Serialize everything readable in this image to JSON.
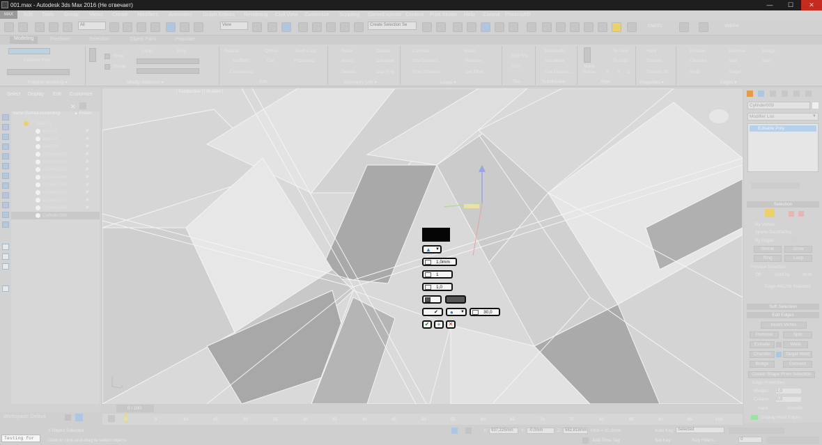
{
  "window": {
    "title": "001.max - Autodesk 3ds Max 2016 (Не отвечает)",
    "minimize": "—",
    "maximize": "☐",
    "close": "✕"
  },
  "app_logo": "MAX",
  "menu": [
    "Edit",
    "Tools",
    "Group",
    "Views",
    "Create",
    "Modifiers",
    "Animation",
    "Graph Editors",
    "Rendering",
    "Civil View",
    "Customize",
    "Scripting",
    "GameExporter",
    "Content",
    "Print Studio",
    "Help",
    "Corona",
    "PhoenixFD"
  ],
  "toolbar": {
    "selection_filter": "All",
    "ref_coord": "View",
    "named_sel": "Create Selection Se",
    "cmpp2": "CMPP2",
    "vmpp4": "VMPP4"
  },
  "ribbon": {
    "tabs": [
      "Modeling",
      "Freeform",
      "Selection",
      "Object Paint",
      "Populate"
    ],
    "editable_poly": "Editable Poly",
    "grow": "Grow",
    "shrink": "Shrink",
    "loop": "Loop",
    "ring": "Ring",
    "repeat": "Repeat",
    "nurms": "NURMS",
    "constraints": "Constraints:",
    "qslice": "QSlice",
    "cut": "Cut",
    "p_connect": "P Connect",
    "swift_loop": "Swift Loop",
    "relax": "Relax",
    "attach": "Attach",
    "detach": "Detach",
    "create": "Create",
    "collapse": "Collapse",
    "cap_poly": "Cap Poly",
    "connect": "Connect",
    "dist_connect": "Dist Connect",
    "flow_connect": "Flow Connect",
    "insert": "Insert",
    "remove_loop": "Remove",
    "set_flow": "Set Flow",
    "edit_tris": "Edit Tris",
    "turn": "Turn",
    "msmooth": "MSmooth",
    "tessellate": "Tessellate",
    "use_displac": "Use Displac...",
    "make_planar": "Make Planar",
    "to_view": "To View",
    "to_grid": "To Grid",
    "xyz": [
      "X",
      "Y",
      "Z"
    ],
    "hard": "Hard",
    "smooth": "Smooth",
    "smooth30": "Smooth 30",
    "extrude": "Extrude",
    "chamfer": "Chamfer",
    "weld": "Weld",
    "remove": "Remove",
    "split": "Split",
    "target": "Target",
    "bridge": "Bridge",
    "spin": "Spin",
    "groups": [
      "Polygon Modeling ▾",
      "Modify Selection ▾",
      "Edit",
      "Geometry (All) ▾",
      "Loops ▾",
      "Tris",
      "Subdivision",
      "Align",
      "Properties ▾",
      "Edges ▾"
    ]
  },
  "scene_explorer": {
    "tabs": [
      "Select",
      "Display",
      "Edit",
      "Customize"
    ],
    "col_name": "Name (Sorted Ascending)",
    "col_frozen": "▲ Frozen",
    "layer": "0 (default)",
    "items": [
      "Box001",
      "Box002",
      "Box003",
      "Cylinder001",
      "Cylinder002",
      "Cylinder003",
      "Cylinder004",
      "Cylinder005",
      "Cylinder006",
      "Cylinder007",
      "Cylinder008",
      "Cylinder009"
    ],
    "frozen_icon": "❄"
  },
  "workspace": "Workspace: Default",
  "viewport": {
    "label": "[ Perspective ] [ Shaded ]",
    "axis_y": "Y",
    "axis_x": "X"
  },
  "caddy": {
    "amount": "1,0mm",
    "segments": "1",
    "tension": "1,0",
    "angle": "30,0"
  },
  "command_panel": {
    "object_name": "Cylinder009",
    "modifier_list": "Modifier List",
    "stack_item": "Editable Poly",
    "selection": "Selection",
    "by_vertex": "By Vertex",
    "ignore_backfacing": "Ignore Backfacing",
    "by_angle": "By Angle:",
    "by_angle_val": "45,0",
    "shrink": "Shrink",
    "grow": "Grow",
    "ring": "Ring",
    "loop": "Loop",
    "preview_selection": "Preview Selection",
    "off": "Off",
    "subobj": "SubObj",
    "multi": "Multi",
    "edge_selected": "Edge 440236 Selected",
    "soft_selection": "Soft Selection",
    "edit_edges": "Edit Edges",
    "insert_vertex": "Insert Vertex",
    "remove": "Remove",
    "split": "Split",
    "extrude": "Extrude",
    "weld": "Weld",
    "chamfer": "Chamfer",
    "target_weld": "Target Weld",
    "bridge": "Bridge",
    "connect": "Connect",
    "create_shape": "Create Shape From Selection",
    "edge_properties": "Edge Properties",
    "weight": "Weight:",
    "weight_val": "1,0",
    "crease": "Crease:",
    "crease_val": "0,0",
    "hard": "Hard",
    "smooth": "Smooth",
    "display_hard_edges": "Display Hard Edges"
  },
  "timeline": {
    "frame": "0 / 100",
    "ticks": [
      "0",
      "5",
      "10",
      "15",
      "20",
      "25",
      "30",
      "35",
      "40",
      "45",
      "50",
      "55",
      "60",
      "65",
      "70",
      "75",
      "80",
      "85",
      "90",
      "95",
      "100"
    ]
  },
  "status": {
    "maxscript": "Testing for",
    "objects_selected": "1 Object Selected",
    "prompt": "Click or click-and-drag to select objects",
    "x_label": "X:",
    "x_val": "937,225mm",
    "y_label": "Y:",
    "y_val": "-0,0mm",
    "z_label": "Z:",
    "z_val": "582,818mm",
    "grid": "Grid = 10,0mm",
    "add_time_tag": "Add Time Tag",
    "auto_key": "Auto Key",
    "auto_key_val": "Selected",
    "set_key": "Set Key",
    "key_filters": "Key Filters...",
    "frame_val": "0"
  }
}
